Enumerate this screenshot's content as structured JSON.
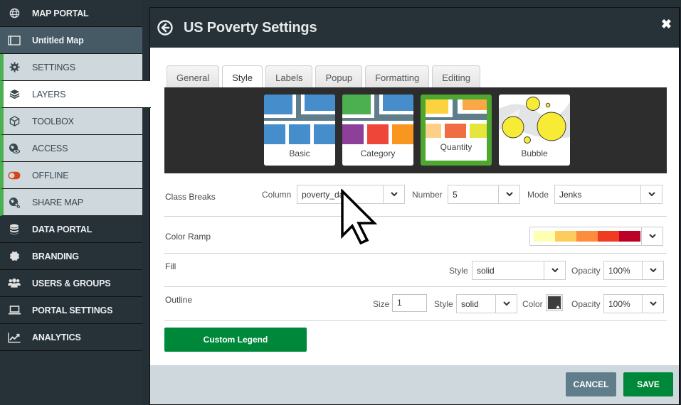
{
  "sidebar": {
    "items": [
      {
        "label": "MAP PORTAL",
        "icon": "globe-icon"
      },
      {
        "label": "Untitled Map",
        "icon": "map-icon"
      },
      {
        "label": "SETTINGS",
        "icon": "gear-icon"
      },
      {
        "label": "LAYERS",
        "icon": "layers-icon"
      },
      {
        "label": "TOOLBOX",
        "icon": "cube-icon"
      },
      {
        "label": "ACCESS",
        "icon": "globe-eye-icon"
      },
      {
        "label": "OFFLINE",
        "icon": "toggle-icon"
      },
      {
        "label": "SHARE MAP",
        "icon": "globe-share-icon"
      },
      {
        "label": "DATA PORTAL",
        "icon": "database-icon"
      },
      {
        "label": "BRANDING",
        "icon": "badge-icon"
      },
      {
        "label": "USERS & GROUPS",
        "icon": "users-icon"
      },
      {
        "label": "PORTAL SETTINGS",
        "icon": "laptop-icon"
      },
      {
        "label": "ANALYTICS",
        "icon": "chart-line-icon"
      }
    ],
    "active_item": "LAYERS"
  },
  "modal": {
    "title": "US Poverty Settings",
    "close_symbol": "✖",
    "tabs": [
      {
        "label": "General",
        "active": false
      },
      {
        "label": "Style",
        "active": true
      },
      {
        "label": "Labels",
        "active": false
      },
      {
        "label": "Popup",
        "active": false
      },
      {
        "label": "Formatting",
        "active": false
      },
      {
        "label": "Editing",
        "active": false
      }
    ],
    "style_types": [
      {
        "label": "Basic",
        "selected": false
      },
      {
        "label": "Category",
        "selected": false
      },
      {
        "label": "Quantity",
        "selected": true
      },
      {
        "label": "Bubble",
        "selected": false
      }
    ],
    "class_breaks": {
      "label": "Class Breaks",
      "column_label": "Column",
      "column_value": "poverty_da",
      "number_label": "Number",
      "number_value": "5",
      "mode_label": "Mode",
      "mode_value": "Jenks"
    },
    "color_ramp": {
      "label": "Color Ramp",
      "colors": [
        "#ffffb2",
        "#fecc5c",
        "#fd8d3c",
        "#f03b20",
        "#bd0026"
      ]
    },
    "fill": {
      "label": "Fill",
      "style_label": "Style",
      "style_value": "solid",
      "opacity_label": "Opacity",
      "opacity_value": "100%"
    },
    "outline": {
      "label": "Outline",
      "size_label": "Size",
      "size_value": "1",
      "style_label": "Style",
      "style_value": "solid",
      "color_label": "Color",
      "color_value": "#3d3d3d",
      "opacity_label": "Opacity",
      "opacity_value": "100%"
    },
    "custom_legend_label": "Custom Legend",
    "footer": {
      "cancel_label": "CANCEL",
      "save_label": "SAVE"
    }
  },
  "colors": {
    "sidebar_bg": "#263238",
    "accent_green": "#00883a",
    "selected_card_green": "#4ea72e",
    "sub_item_marker": "#4caf50",
    "cancel_gray": "#607d8b"
  }
}
